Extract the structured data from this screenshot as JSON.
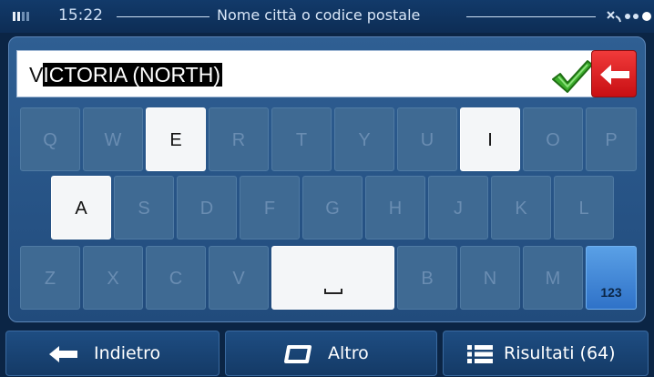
{
  "status_bar": {
    "time": "15:22",
    "title": "Nome città o codice postale"
  },
  "search": {
    "value": "VICTORIA (NORTH)",
    "value_first_char": "V",
    "value_selected": "ICTORIA (NORTH)",
    "confirm_icon": "green-checkmark-icon",
    "backspace_icon": "backspace-arrow-icon"
  },
  "keyboard": {
    "row1": [
      "Q",
      "W",
      "E",
      "R",
      "T",
      "Y",
      "U",
      "I",
      "O",
      "P"
    ],
    "row2": [
      "A",
      "S",
      "D",
      "F",
      "G",
      "H",
      "J",
      "K",
      "L"
    ],
    "row3": [
      "Z",
      "X",
      "C",
      "V",
      "B",
      "N",
      "M"
    ],
    "enabled_keys": [
      "E",
      "I",
      "A",
      "space"
    ],
    "space_label": "␣",
    "numeric_label": "123"
  },
  "bottom_bar": {
    "back_label": "Indietro",
    "more_label": "Altro",
    "results_label": "Risultati (64)"
  },
  "colors": {
    "background": "#0b2545",
    "key_disabled": "#3f6a93",
    "key_enabled": "#f4f6f8",
    "backspace": "#e01e22",
    "numeric_key": "#3d86d8"
  }
}
